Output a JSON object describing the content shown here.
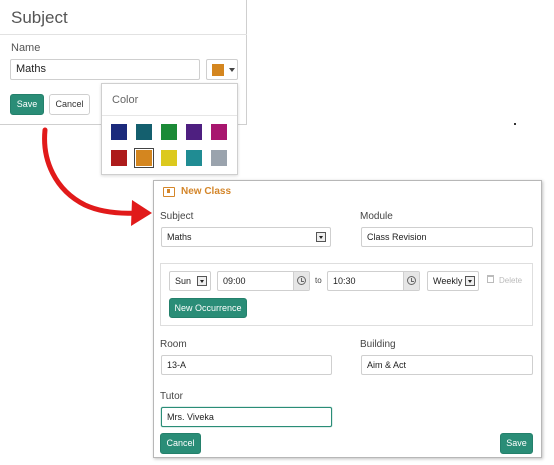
{
  "subject_dialog": {
    "title": "Subject",
    "name_label": "Name",
    "name_value": "Maths",
    "selected_color": "#d4861f",
    "save_label": "Save",
    "cancel_label": "Cancel"
  },
  "color_popup": {
    "title": "Color",
    "colors": [
      "#1b2a7c",
      "#145f6e",
      "#1b8a37",
      "#4e1f80",
      "#a8166e",
      "#ad1b1b",
      "#d4861f",
      "#dcc91e",
      "#208c93",
      "#9aa3ad"
    ],
    "selected_index": 6
  },
  "new_class": {
    "title": "New Class",
    "subject_label": "Subject",
    "subject_value": "Maths",
    "module_label": "Module",
    "module_value": "Class Revision",
    "occurrence": {
      "day": "Sun",
      "start_time": "09:00",
      "to_label": "to",
      "end_time": "10:30",
      "frequency": "Weekly",
      "delete_label": "Delete",
      "new_occurrence_label": "New Occurrence"
    },
    "room_label": "Room",
    "room_value": "13-A",
    "building_label": "Building",
    "building_value": "Aim & Act",
    "tutor_label": "Tutor",
    "tutor_value": "Mrs. Viveka",
    "cancel_label": "Cancel",
    "save_label": "Save"
  },
  "colors": {
    "accent_green": "#2a8d77",
    "title_orange": "#d4862a",
    "arrow_red": "#e11a1a"
  }
}
